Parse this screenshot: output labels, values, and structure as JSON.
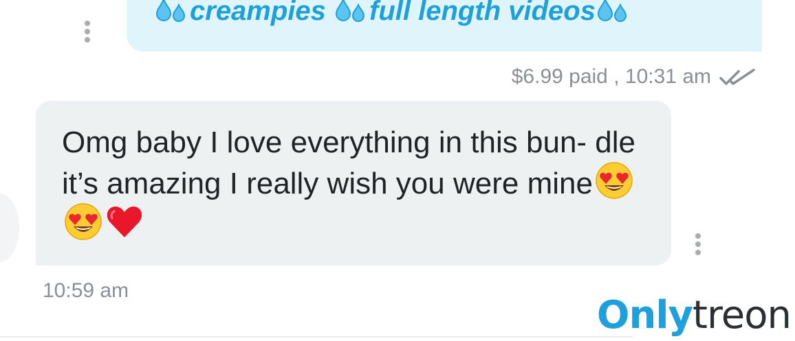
{
  "chat": {
    "outgoing": {
      "text": "creampies",
      "text2": "full length videos",
      "price_paid": "$6.99 paid",
      "separator": ",",
      "time": "10:31 am",
      "status_icon": "double-check-icon",
      "bubble_color": "#dff5fb",
      "text_color": "#1ea0dc"
    },
    "incoming": {
      "text": "Omg baby I love everything in this bun- dle it’s amazing I really wish you were mine",
      "emojis": [
        "heart-eyes-icon",
        "heart-eyes-icon",
        "red-heart-icon"
      ],
      "time": "10:59 am",
      "bubble_color": "#eef1f2"
    }
  },
  "watermark": {
    "part1": "Only",
    "part2": "treon",
    "accent": "#1ea0dc"
  }
}
